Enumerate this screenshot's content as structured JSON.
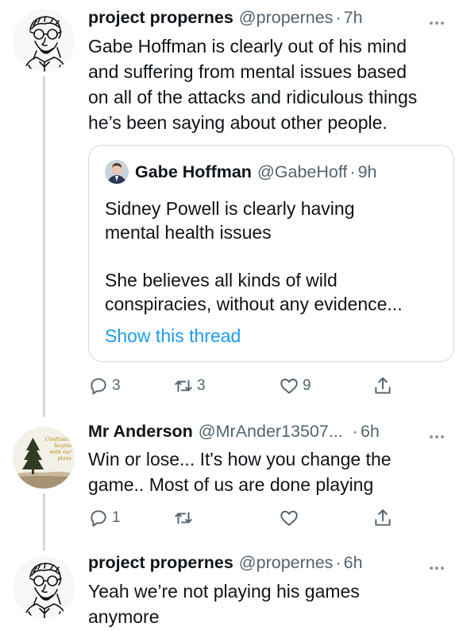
{
  "tweets": [
    {
      "name": "project propernes",
      "handle": "@propernes",
      "separator": "·",
      "time": "7h",
      "text": "Gabe Hoffman is clearly out of his mind\nand suffering from mental issues based\non all of the attacks and ridiculous things\nhe’s been saying about other people.",
      "quote": {
        "name": "Gabe Hoffman",
        "handle": "@GabeHoff",
        "separator": "·",
        "time": "9h",
        "text": "Sidney Powell is clearly having\nmental health issues\n\nShe believes all kinds of wild\nconspiracies, without any evidence...",
        "link": "Show this thread"
      },
      "reply_count": "3",
      "retweet_count": "3",
      "like_count": "9"
    },
    {
      "name": "Mr Anderson",
      "handle": "@MrAnder13507...",
      "separator": "·",
      "time": "6h",
      "avatar_text": "Confusion begins with our plans",
      "text": "Win or lose... It's how you change the\ngame.. Most of us are done playing",
      "reply_count": "1",
      "retweet_count": "",
      "like_count": ""
    },
    {
      "name": "project propernes",
      "handle": "@propernes",
      "separator": "·",
      "time": "6h",
      "text": "Yeah we’re not playing his games\nanymore"
    }
  ],
  "colors": {
    "text": "#0f1419",
    "secondary": "#536471",
    "link": "#1d9bf0",
    "border": "#cfd9de"
  },
  "icons": [
    "more-icon",
    "reply-icon",
    "retweet-icon",
    "like-icon",
    "share-icon"
  ]
}
